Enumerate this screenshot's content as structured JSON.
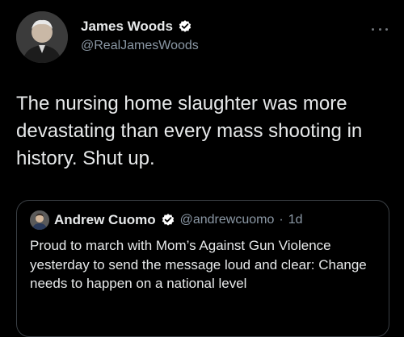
{
  "tweet": {
    "author": {
      "display_name": "James Woods",
      "handle": "@RealJamesWoods",
      "verified": true,
      "avatar_icon": "avatar-photo"
    },
    "text": "The nursing home slaughter was more devastating than every mass shooting in history. Shut up.",
    "more_icon": "ellipsis-icon"
  },
  "quoted_tweet": {
    "author": {
      "display_name": "Andrew Cuomo",
      "handle": "@andrewcuomo",
      "verified": true,
      "avatar_icon": "avatar-photo"
    },
    "separator": "·",
    "time": "1d",
    "text": "Proud to march with Mom’s Against Gun Violence yesterday to send the message loud and clear: Change needs to happen on a national level"
  },
  "colors": {
    "background": "#000000",
    "text_primary": "#e7e9ea",
    "text_secondary": "#8b98a5",
    "verified_blue": "#1d9bf0",
    "card_border": "#3a3f44"
  }
}
